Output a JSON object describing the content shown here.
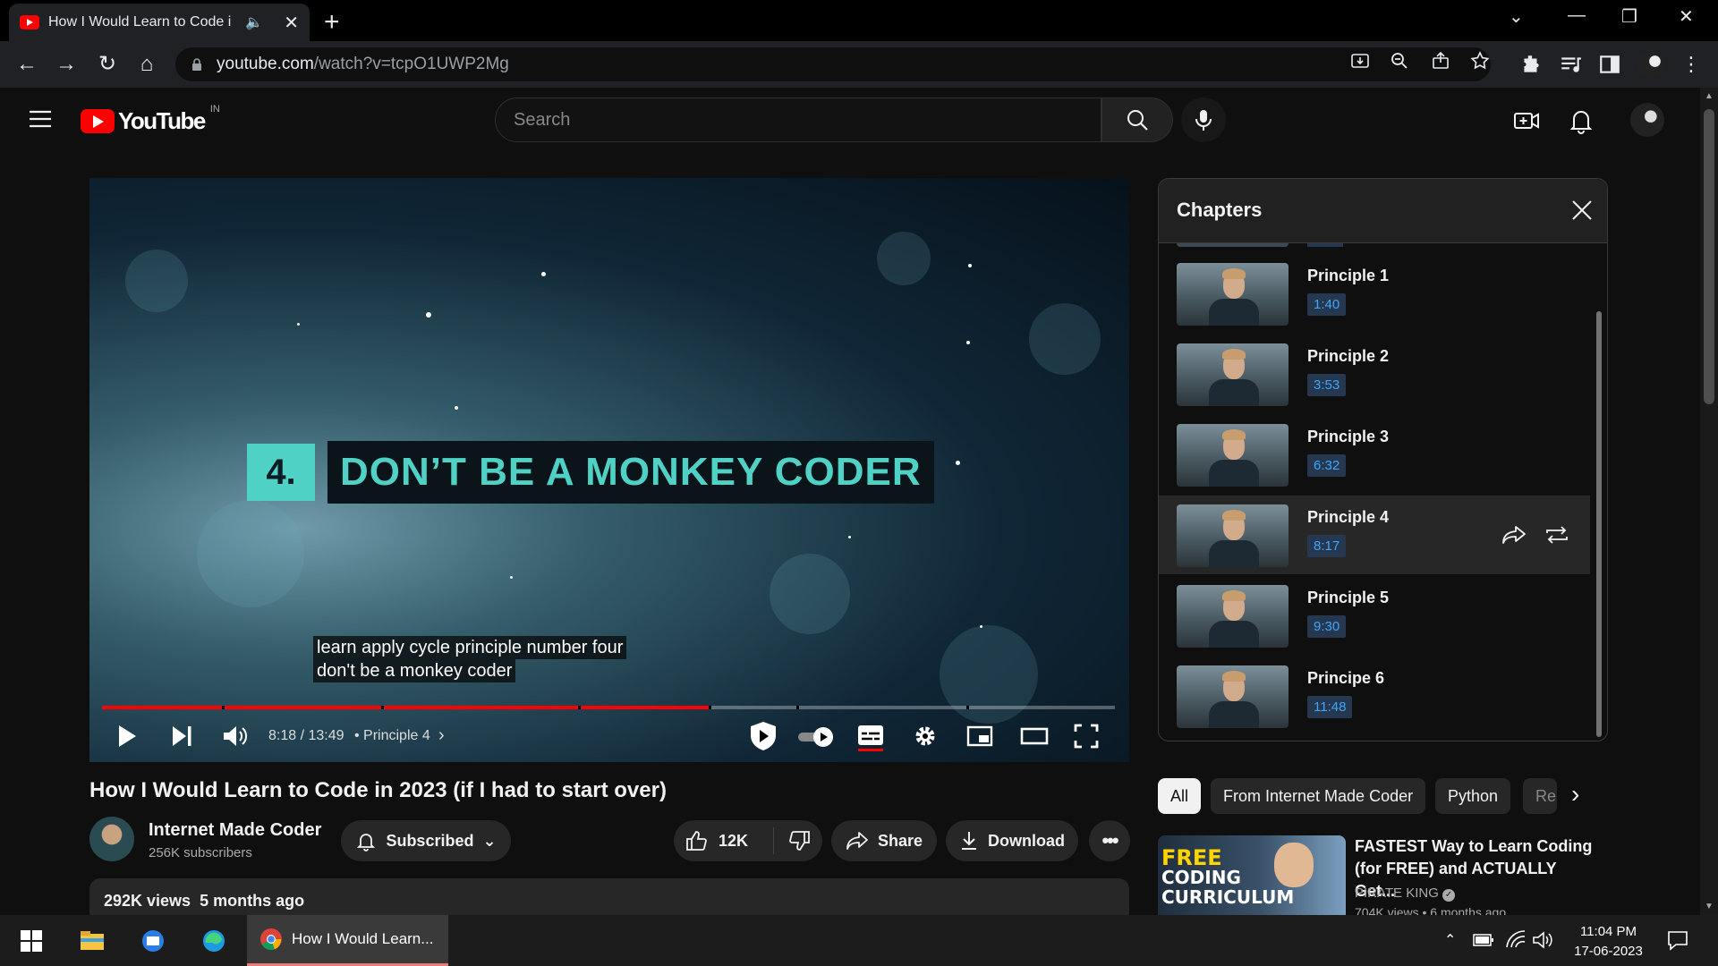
{
  "browser": {
    "tab_title": "How I Would Learn to Code i",
    "url_host": "youtube.com",
    "url_path": "/watch?v=tcpO1UWP2Mg"
  },
  "yt": {
    "logo_text": "YouTube",
    "country_code": "IN",
    "search_placeholder": "Search"
  },
  "player": {
    "card_number": "4.",
    "card_text": "DON’T BE A MONKEY CODER",
    "caption_line1": "learn apply cycle principle number four",
    "caption_line2": "don't be a monkey coder",
    "time_text": "8:18 / 13:49",
    "chapter_text": "• Principle 4",
    "progress_fraction": 0.602
  },
  "video": {
    "title": "How I Would Learn to Code in 2023 (if I had to start over)",
    "channel_name": "Internet Made Coder",
    "subscribers": "256K subscribers",
    "subscribed_label": "Subscribed",
    "likes": "12K",
    "share_label": "Share",
    "download_label": "Download",
    "views": "292K views",
    "uploaded": "5 months ago"
  },
  "chapters": {
    "heading": "Chapters",
    "items": [
      {
        "name": "Principle 1",
        "time": "1:40",
        "active": false
      },
      {
        "name": "Principle 2",
        "time": "3:53",
        "active": false
      },
      {
        "name": "Principle 3",
        "time": "6:32",
        "active": false
      },
      {
        "name": "Principle 4",
        "time": "8:17",
        "active": true
      },
      {
        "name": "Principle 5",
        "time": "9:30",
        "active": false
      },
      {
        "name": "Principe 6",
        "time": "11:48",
        "active": false
      }
    ]
  },
  "chips": [
    "All",
    "From Internet Made Coder",
    "Python",
    "Re"
  ],
  "recommendation": {
    "thumb_top": "FREE",
    "thumb_mid": "CODING",
    "thumb_bottom": "CURRICULUM",
    "title": "FASTEST Way to Learn Coding (for FREE) and ACTUALLY Get...",
    "channel": "PIRATE KING",
    "meta": "704K views • 6 months ago"
  },
  "taskbar": {
    "chrome_label": "How I Would Learn...",
    "time": "11:04 PM",
    "date": "17-06-2023"
  },
  "colors": {
    "yt_red": "#ff0000",
    "card_teal": "#4fd1c5",
    "chapter_time_blue": "#3ea6ff"
  }
}
